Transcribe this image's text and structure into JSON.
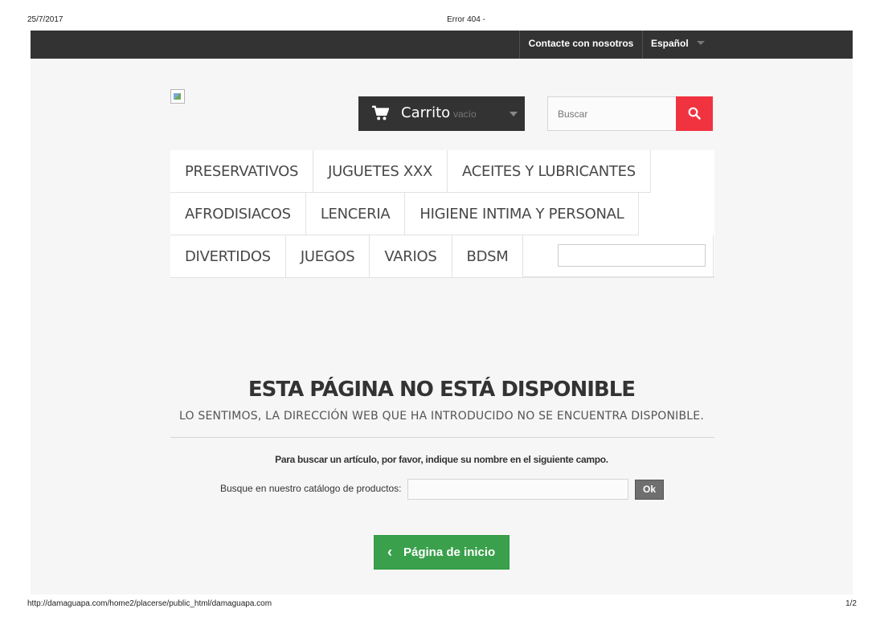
{
  "print": {
    "date": "25/7/2017",
    "title": "Error 404 -",
    "url": "http://damaguapa.com/home2/placerse/public_html/damaguapa.com",
    "page": "1/2"
  },
  "topbar": {
    "contact": "Contacte con nosotros",
    "language": "Español"
  },
  "cart": {
    "label": "Carrito",
    "state": "vacío"
  },
  "search": {
    "placeholder": "Buscar"
  },
  "menu": {
    "row1": [
      "PRESERVATIVOS",
      "JUGUETES XXX",
      "ACEITES Y LUBRICANTES"
    ],
    "row2": [
      "AFRODISIACOS",
      "LENCERIA",
      "HIGIENE INTIMA Y PERSONAL"
    ],
    "row3": [
      "DIVERTIDOS",
      "JUEGOS",
      "VARIOS",
      "BDSM"
    ]
  },
  "error": {
    "title": "ESTA PÁGINA NO ESTÁ DISPONIBLE",
    "subtitle": "LO SENTIMOS, LA DIRECCIÓN WEB QUE HA INTRODUCIDO NO SE ENCUENTRA DISPONIBLE.",
    "help": "Para buscar un artículo, por favor, indique su nombre en el siguiente campo.",
    "catalog_label": "Busque en nuestro catálogo de productos:",
    "ok": "Ok",
    "home": "Página de inicio"
  },
  "colors": {
    "topbar": "#333333",
    "search_button": "#f13340",
    "home_button": "#3aa04c"
  },
  "icons": [
    "cart-icon",
    "search-icon",
    "chevron-left-icon",
    "chevron-down-icon",
    "broken-image-icon"
  ]
}
